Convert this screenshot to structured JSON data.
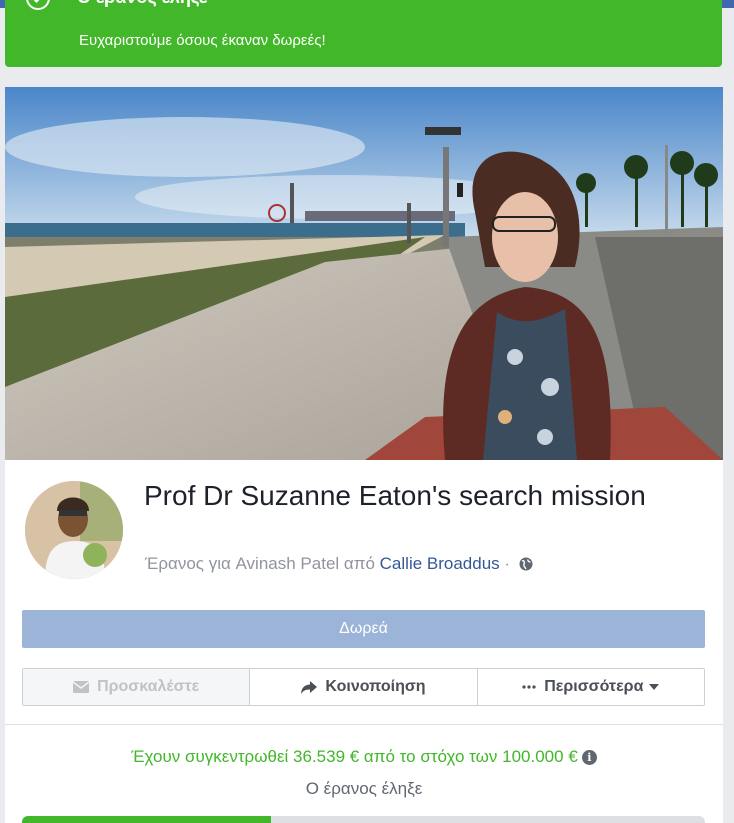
{
  "banner": {
    "headline": "Ο έρανος έληξε",
    "thanks": "Ευχαριστούμε όσους έκαναν δωρεές!"
  },
  "fundraiser": {
    "title": "Prof Dr Suzanne Eaton's search mission",
    "subtitle_prefix": "Έρανος για Avinash Patel από",
    "organizer": "Callie Broaddus",
    "privacy_sep": "·"
  },
  "actions": {
    "donate_label": "Δωρεά",
    "invite_label": "Προσκαλέστε",
    "share_label": "Κοινοποίηση",
    "more_label": "Περισσότερα"
  },
  "progress": {
    "raised_text": "Έχουν συγκεντρωθεί 36.539 € από το στόχο των 100.000 €",
    "raised": 36539,
    "goal": 100000,
    "fraction": 0.365,
    "status": "Ο έρανος έληξε"
  },
  "colors": {
    "brand": "#4267b2",
    "success": "#42b72a",
    "donate_disabled": "#9cb4d8",
    "link": "#365899"
  }
}
